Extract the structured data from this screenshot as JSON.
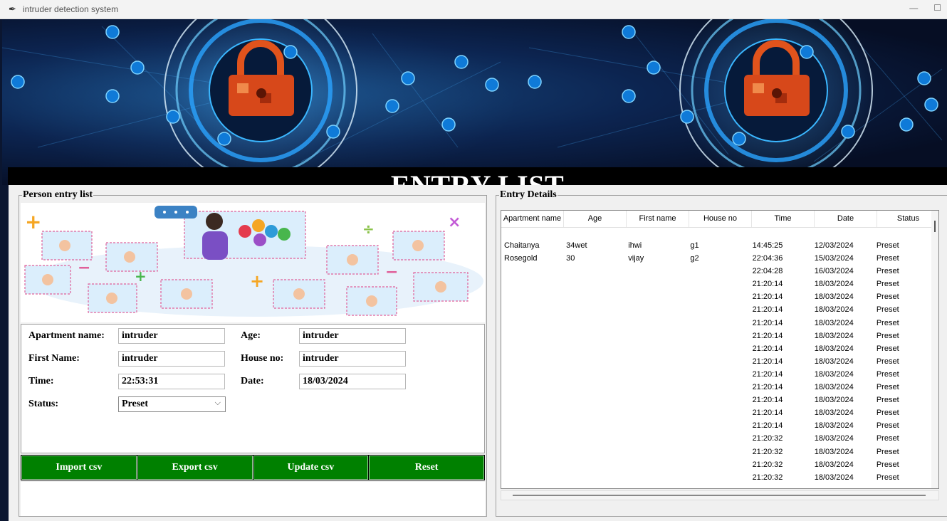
{
  "window": {
    "title": "intruder detection system",
    "minimize": "—",
    "maximize": "☐"
  },
  "banner": {
    "title": "ENTRY LIST"
  },
  "left_frame": {
    "title": "Person entry list"
  },
  "form": {
    "apartment_label": "Apartment name:",
    "apartment_value": "intruder",
    "age_label": "Age:",
    "age_value": "intruder",
    "first_name_label": "First Name:",
    "first_name_value": "intruder",
    "house_label": "House no:",
    "house_value": "intruder",
    "time_label": "Time:",
    "time_value": "22:53:31",
    "date_label": "Date:",
    "date_value": "18/03/2024",
    "status_label": "Status:",
    "status_value": "Preset"
  },
  "buttons": {
    "import": "Import csv",
    "export": "Export csv",
    "update": "Update csv",
    "reset": "Reset"
  },
  "colors": {
    "button_green": "#008000",
    "banner_bg": "#0c2450",
    "lock": "#e0531c"
  },
  "right_frame": {
    "title": "Entry Details",
    "columns": [
      "Apartment name",
      "Age",
      "First name",
      "House no",
      "Time",
      "Date",
      "Status"
    ],
    "rows": [
      [
        "Chaitanya",
        "34wet",
        "ihwi",
        "g1",
        "14:45:25",
        "12/03/2024",
        "Preset"
      ],
      [
        "Rosegold",
        "30",
        "vijay",
        "g2",
        "22:04:36",
        "15/03/2024",
        "Preset"
      ],
      [
        "",
        "",
        "",
        "",
        "22:04:28",
        "16/03/2024",
        "Preset"
      ],
      [
        "",
        "",
        "",
        "",
        "21:20:14",
        "18/03/2024",
        "Preset"
      ],
      [
        "",
        "",
        "",
        "",
        "21:20:14",
        "18/03/2024",
        "Preset"
      ],
      [
        "",
        "",
        "",
        "",
        "21:20:14",
        "18/03/2024",
        "Preset"
      ],
      [
        "",
        "",
        "",
        "",
        "21:20:14",
        "18/03/2024",
        "Preset"
      ],
      [
        "",
        "",
        "",
        "",
        "21:20:14",
        "18/03/2024",
        "Preset"
      ],
      [
        "",
        "",
        "",
        "",
        "21:20:14",
        "18/03/2024",
        "Preset"
      ],
      [
        "",
        "",
        "",
        "",
        "21:20:14",
        "18/03/2024",
        "Preset"
      ],
      [
        "",
        "",
        "",
        "",
        "21:20:14",
        "18/03/2024",
        "Preset"
      ],
      [
        "",
        "",
        "",
        "",
        "21:20:14",
        "18/03/2024",
        "Preset"
      ],
      [
        "",
        "",
        "",
        "",
        "21:20:14",
        "18/03/2024",
        "Preset"
      ],
      [
        "",
        "",
        "",
        "",
        "21:20:14",
        "18/03/2024",
        "Preset"
      ],
      [
        "",
        "",
        "",
        "",
        "21:20:14",
        "18/03/2024",
        "Preset"
      ],
      [
        "",
        "",
        "",
        "",
        "21:20:32",
        "18/03/2024",
        "Preset"
      ],
      [
        "",
        "",
        "",
        "",
        "21:20:32",
        "18/03/2024",
        "Preset"
      ],
      [
        "",
        "",
        "",
        "",
        "21:20:32",
        "18/03/2024",
        "Preset"
      ],
      [
        "",
        "",
        "",
        "",
        "21:20:32",
        "18/03/2024",
        "Preset"
      ]
    ]
  }
}
